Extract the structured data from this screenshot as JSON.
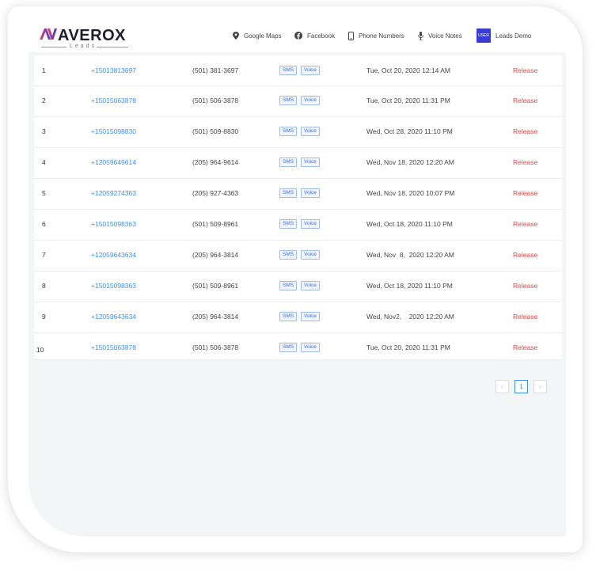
{
  "brand": {
    "name": "AVEROX",
    "sub": "Leads"
  },
  "nav": {
    "google_maps": "Google Maps",
    "facebook": "Facebook",
    "phone_numbers": "Phone Numbers",
    "voice_notes": "Voice Notes",
    "user_badge": "USER",
    "user_name": "Leads Demo"
  },
  "rows": [
    {
      "num": "1",
      "number": "+15013813697",
      "formatted": "(501) 381-3697",
      "sms": "SMS",
      "voice": "Voice",
      "date": "Tue, Oct 20, 2020 12:14 AM",
      "action": "Release"
    },
    {
      "num": "2",
      "number": "+15015063878",
      "formatted": "(501) 506-3878",
      "sms": "SMS",
      "voice": "Voice",
      "date": "Tue, Oct 20, 2020 11:31 PM",
      "action": "Release"
    },
    {
      "num": "3",
      "number": "+15015098830",
      "formatted": "(501) 509-8830",
      "sms": "SMS",
      "voice": "Voice",
      "date": "Wed, Oct 28, 2020 11:10 PM",
      "action": "Release"
    },
    {
      "num": "4",
      "number": "+12059649614",
      "formatted": "(205) 964-9614",
      "sms": "SMS",
      "voice": "Voice",
      "date": "Wed, Nov 18, 2020 12:20 AM",
      "action": "Release"
    },
    {
      "num": "5",
      "number": "+12059274363",
      "formatted": "(205) 927-4363",
      "sms": "SMS",
      "voice": "Voice",
      "date": "Wed, Nov 18, 2020 10:07 PM",
      "action": "Release"
    },
    {
      "num": "6",
      "number": "+15015098363",
      "formatted": "(501) 509-8961",
      "sms": "SMS",
      "voice": "Voice",
      "date": "Wed, Oct 18, 2020 11:10 PM",
      "action": "Release"
    },
    {
      "num": "7",
      "number": "+12059643634",
      "formatted": "(205) 964-3814",
      "sms": "SMS",
      "voice": "Voice",
      "date": "Wed, Nov  8,  2020 12:20 AM",
      "action": "Release"
    },
    {
      "num": "8",
      "number": "+15015098363",
      "formatted": "(501) 509-8961",
      "sms": "SMS",
      "voice": "Voice",
      "date": "Wed, Oct 18, 2020 11:10 PM",
      "action": "Release"
    },
    {
      "num": "9",
      "number": "+12059643634",
      "formatted": "(205) 964-3814",
      "sms": "SMS",
      "voice": "Voice",
      "date": "Wed, Nov2,    2020 12:20 AM",
      "action": "Release"
    },
    {
      "num": "10",
      "number": "+15015063878",
      "formatted": "(501) 506-3878",
      "sms": "SMS",
      "voice": "Voice",
      "date": "Tue, Oct 20, 2020 11:31 PM",
      "action": "Release"
    }
  ],
  "pagination": {
    "prev": "‹",
    "current": "1",
    "next": "›"
  },
  "colors": {
    "accent": "#3d8ef0",
    "release": "#ef3b3b",
    "user_badge": "#3b3bd6"
  }
}
